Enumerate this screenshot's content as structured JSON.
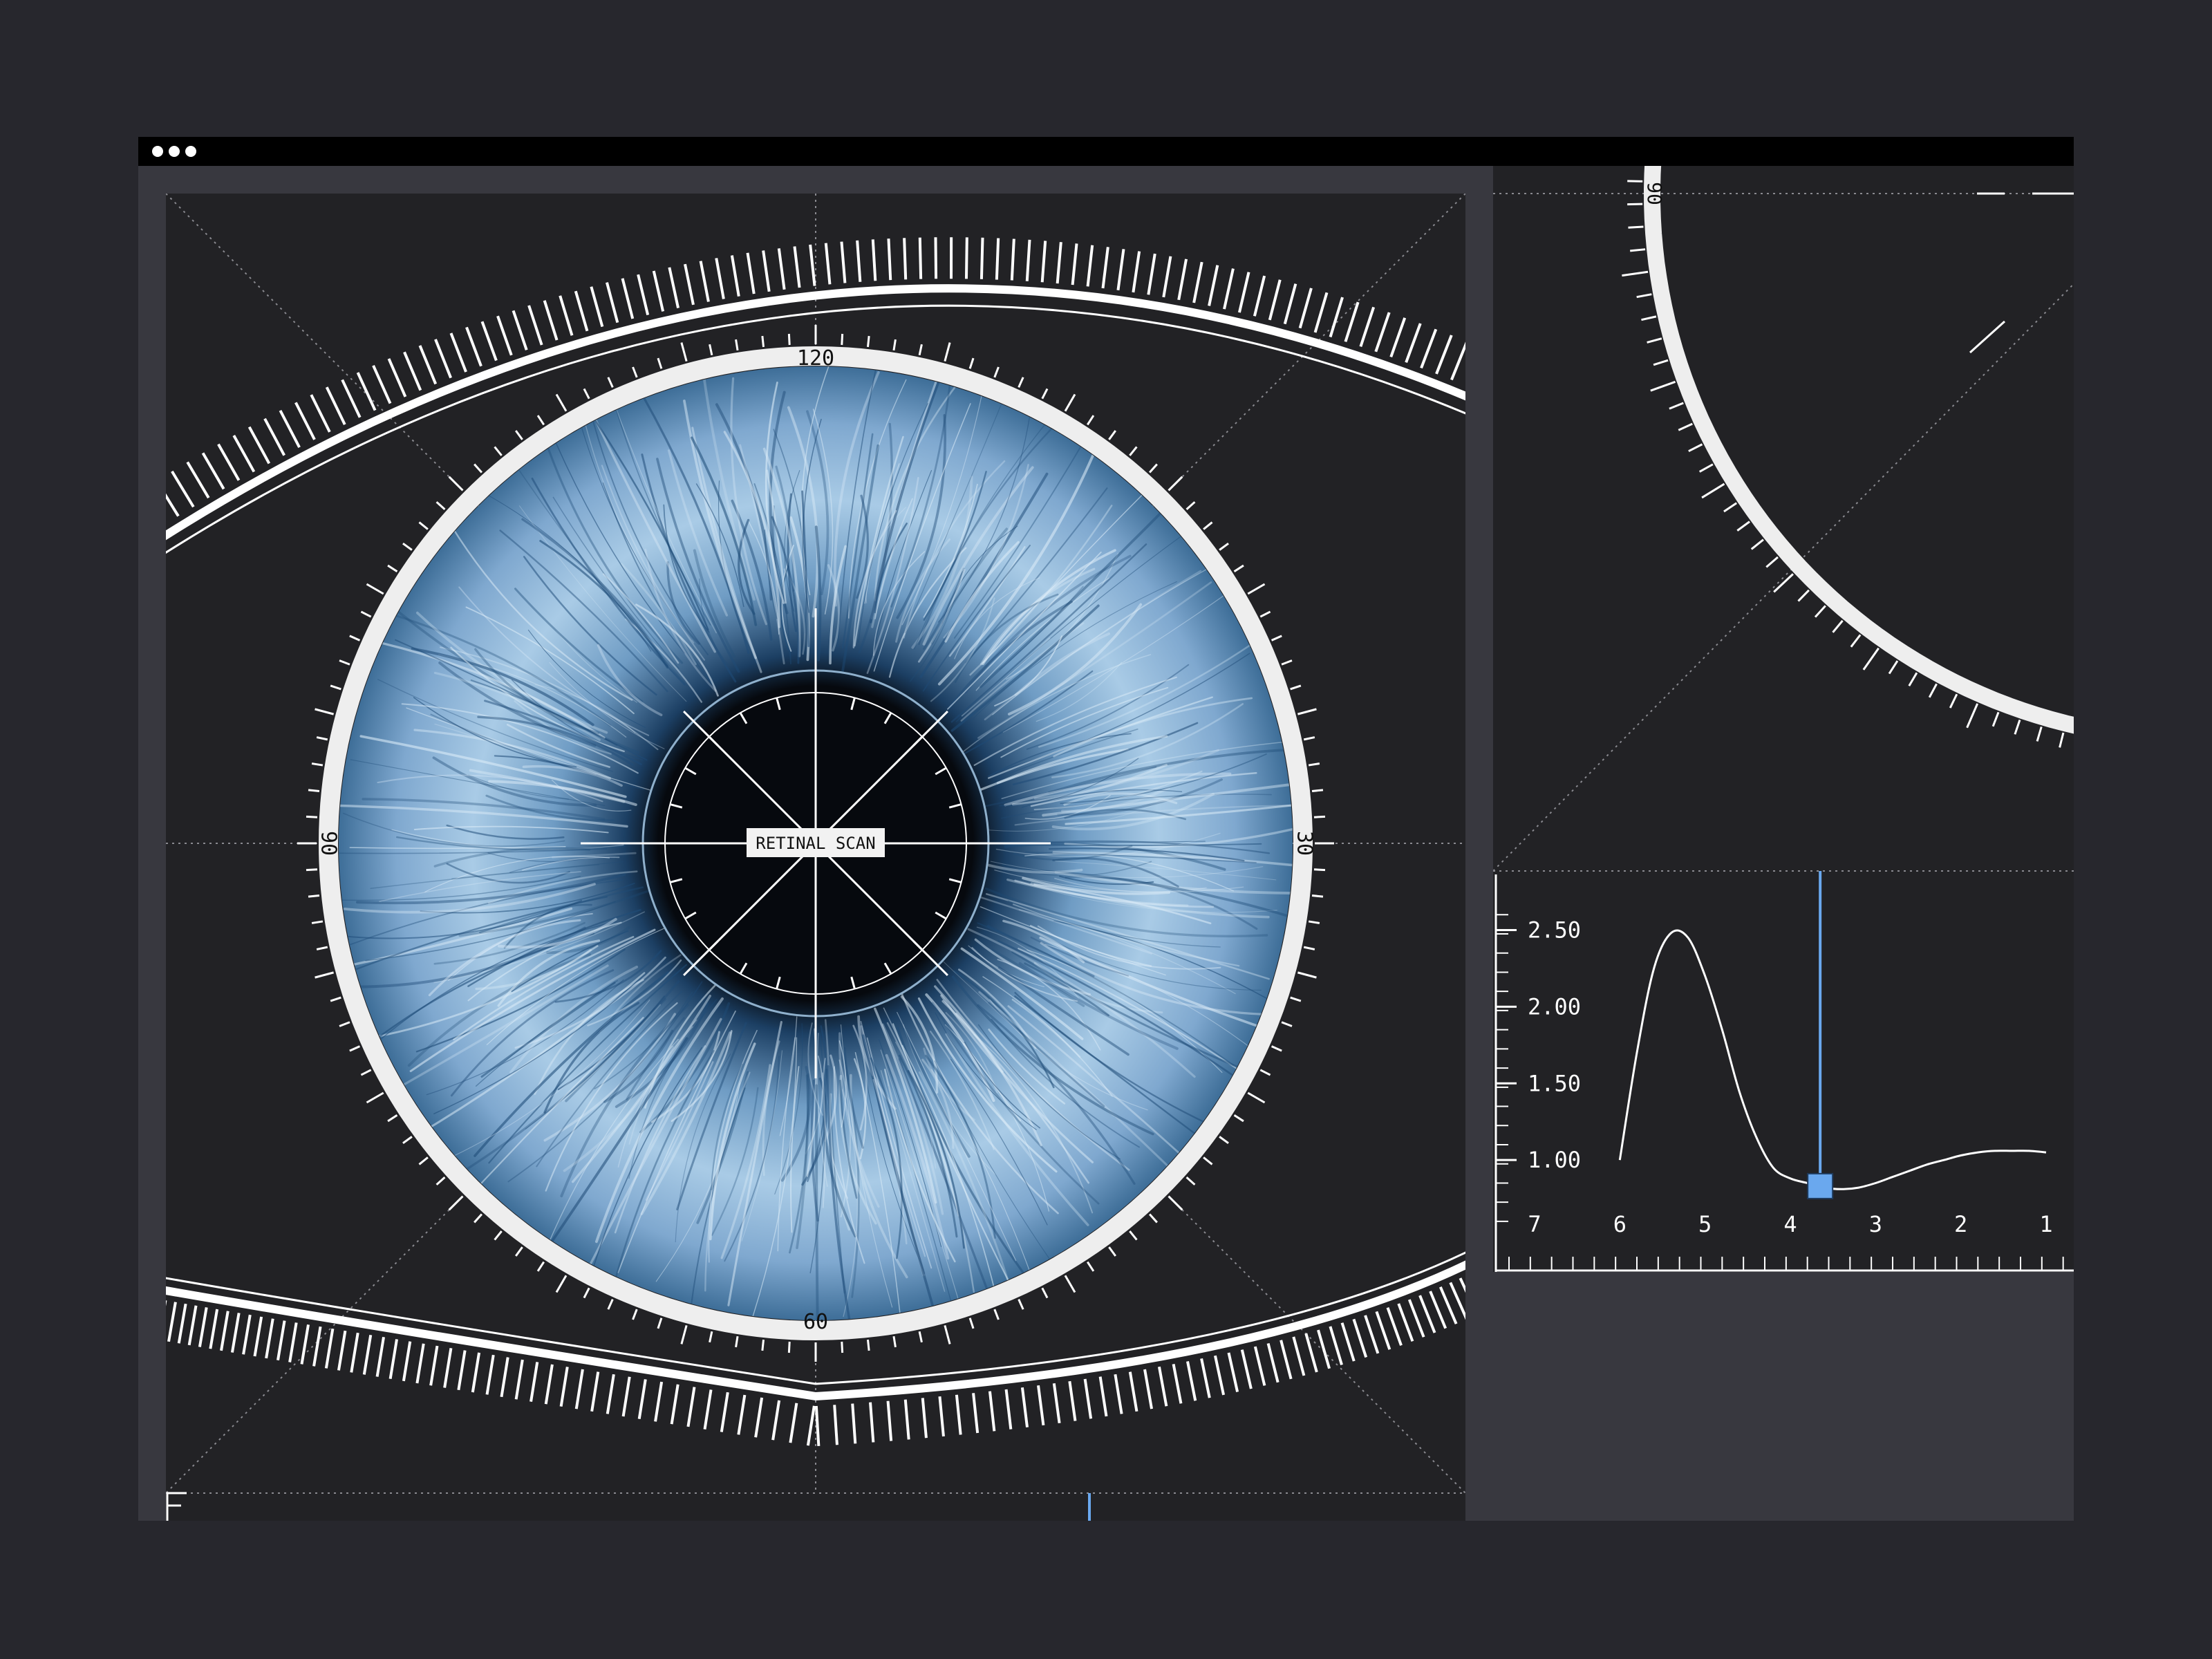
{
  "window": {
    "controls": [
      "close",
      "minimize",
      "maximize"
    ]
  },
  "scan": {
    "center_label": "RETINAL SCAN",
    "ring_labels": {
      "top": "120",
      "right": "30",
      "bottom": "60",
      "left": "90"
    },
    "iris_colors": {
      "outer": "#3e6e98",
      "mid": "#a9cbe6",
      "inner": "#1c3f63",
      "pupil": "#06090e"
    }
  },
  "side_panel": {
    "ring_label": "90"
  },
  "chart_data": {
    "type": "line",
    "x": [
      6.0,
      5.8,
      5.6,
      5.4,
      5.2,
      5.0,
      4.8,
      4.6,
      4.4,
      4.2,
      4.0,
      3.8,
      3.6,
      3.4,
      3.2,
      3.0,
      2.8,
      2.6,
      2.4,
      2.2,
      2.0,
      1.8,
      1.6,
      1.4,
      1.2,
      1.0
    ],
    "series": [
      {
        "values": [
          1.0,
          1.7,
          2.25,
          2.48,
          2.45,
          2.2,
          1.85,
          1.45,
          1.15,
          0.95,
          0.88,
          0.85,
          0.82,
          0.81,
          0.82,
          0.85,
          0.89,
          0.93,
          0.97,
          1.0,
          1.03,
          1.05,
          1.06,
          1.06,
          1.06,
          1.05
        ]
      }
    ],
    "xticks": [
      "7",
      "6",
      "5",
      "4",
      "3",
      "2",
      "1"
    ],
    "yticks": [
      "2.50",
      "2.00",
      "1.50",
      "1.00"
    ],
    "xlim": [
      7,
      1
    ],
    "ylim": [
      0.55,
      2.75
    ],
    "cursor": {
      "x": 3.65,
      "y": 0.83
    },
    "colors": {
      "line": "#ffffff",
      "cursor": "#6aa8ee"
    }
  }
}
